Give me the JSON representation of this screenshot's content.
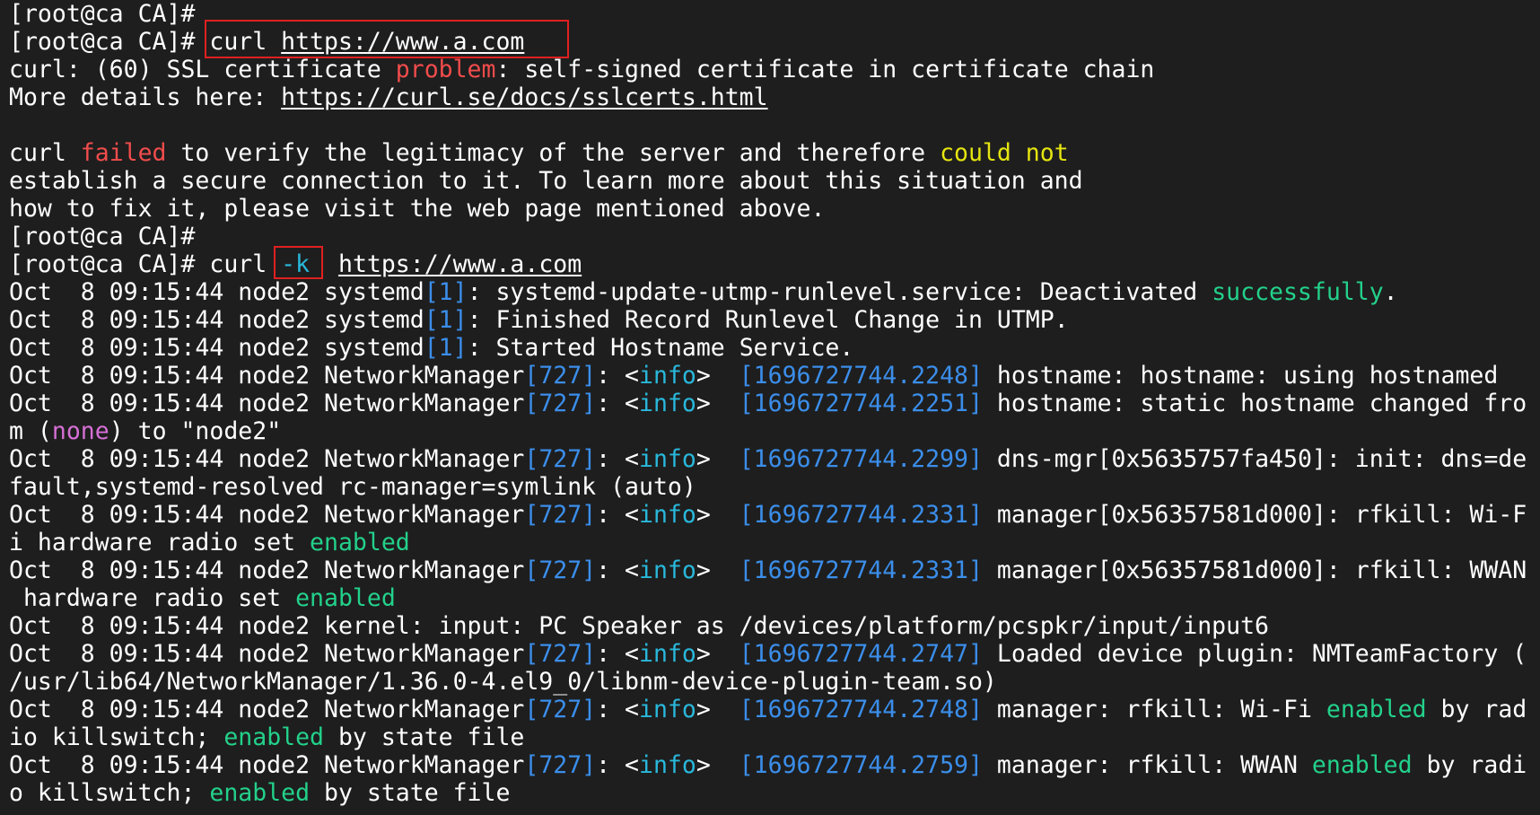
{
  "terminal": {
    "colors": {
      "background": "#1e1e1e",
      "default": "#ffffff",
      "red": "#f14c4c",
      "yellow": "#e5e510",
      "green": "#23d18b",
      "blue": "#3b8eea",
      "cyan": "#29b8db",
      "magenta": "#d670d6",
      "highlight_box": "#e02020"
    },
    "lines": [
      [
        {
          "t": "[root@ca CA]#"
        }
      ],
      [
        {
          "t": "[root@ca CA]# curl "
        },
        {
          "t": "https://www.a.com",
          "c": "default",
          "u": true
        }
      ],
      [
        {
          "t": "curl: (60) SSL certificate "
        },
        {
          "t": "problem",
          "c": "red"
        },
        {
          "t": ": self-signed certificate in certificate chain"
        }
      ],
      [
        {
          "t": "More details here: "
        },
        {
          "t": "https://curl.se/docs/sslcerts.html",
          "u": true
        }
      ],
      [
        {
          "t": ""
        }
      ],
      [
        {
          "t": "curl "
        },
        {
          "t": "failed",
          "c": "red"
        },
        {
          "t": " to verify the legitimacy of the server and therefore "
        },
        {
          "t": "could not",
          "c": "yellow"
        }
      ],
      [
        {
          "t": "establish a secure connection to it. To learn more about this situation and"
        }
      ],
      [
        {
          "t": "how to fix it, please visit the web page mentioned above."
        }
      ],
      [
        {
          "t": "[root@ca CA]#"
        }
      ],
      [
        {
          "t": "[root@ca CA]# curl "
        },
        {
          "t": "-k",
          "c": "cyan"
        },
        {
          "t": "  "
        },
        {
          "t": "https://www.a.com",
          "u": true
        }
      ],
      [
        {
          "t": "Oct  8 09:15:44 node2 systemd"
        },
        {
          "t": "[1]",
          "c": "blue"
        },
        {
          "t": ": systemd-update-utmp-runlevel.service: Deactivated "
        },
        {
          "t": "successfully",
          "c": "green"
        },
        {
          "t": "."
        }
      ],
      [
        {
          "t": "Oct  8 09:15:44 node2 systemd"
        },
        {
          "t": "[1]",
          "c": "blue"
        },
        {
          "t": ": Finished Record Runlevel Change in UTMP."
        }
      ],
      [
        {
          "t": "Oct  8 09:15:44 node2 systemd"
        },
        {
          "t": "[1]",
          "c": "blue"
        },
        {
          "t": ": Started Hostname Service."
        }
      ],
      [
        {
          "t": "Oct  8 09:15:44 node2 NetworkManager"
        },
        {
          "t": "[727]",
          "c": "blue"
        },
        {
          "t": ": <"
        },
        {
          "t": "info",
          "c": "cyan"
        },
        {
          "t": ">  "
        },
        {
          "t": "[1696727744.2248]",
          "c": "blue"
        },
        {
          "t": " hostname: hostname: using hostnamed"
        }
      ],
      [
        {
          "t": "Oct  8 09:15:44 node2 NetworkManager"
        },
        {
          "t": "[727]",
          "c": "blue"
        },
        {
          "t": ": <"
        },
        {
          "t": "info",
          "c": "cyan"
        },
        {
          "t": ">  "
        },
        {
          "t": "[1696727744.2251]",
          "c": "blue"
        },
        {
          "t": " hostname: static hostname changed fro"
        }
      ],
      [
        {
          "t": "m ("
        },
        {
          "t": "none",
          "c": "magenta"
        },
        {
          "t": ") to \"node2\""
        }
      ],
      [
        {
          "t": "Oct  8 09:15:44 node2 NetworkManager"
        },
        {
          "t": "[727]",
          "c": "blue"
        },
        {
          "t": ": <"
        },
        {
          "t": "info",
          "c": "cyan"
        },
        {
          "t": ">  "
        },
        {
          "t": "[1696727744.2299]",
          "c": "blue"
        },
        {
          "t": " dns-mgr[0x5635757fa450]: init: dns=de"
        }
      ],
      [
        {
          "t": "fault,systemd-resolved rc-manager=symlink (auto)"
        }
      ],
      [
        {
          "t": "Oct  8 09:15:44 node2 NetworkManager"
        },
        {
          "t": "[727]",
          "c": "blue"
        },
        {
          "t": ": <"
        },
        {
          "t": "info",
          "c": "cyan"
        },
        {
          "t": ">  "
        },
        {
          "t": "[1696727744.2331]",
          "c": "blue"
        },
        {
          "t": " manager[0x56357581d000]: rfkill: Wi-F"
        }
      ],
      [
        {
          "t": "i hardware radio set "
        },
        {
          "t": "enabled",
          "c": "green"
        }
      ],
      [
        {
          "t": "Oct  8 09:15:44 node2 NetworkManager"
        },
        {
          "t": "[727]",
          "c": "blue"
        },
        {
          "t": ": <"
        },
        {
          "t": "info",
          "c": "cyan"
        },
        {
          "t": ">  "
        },
        {
          "t": "[1696727744.2331]",
          "c": "blue"
        },
        {
          "t": " manager[0x56357581d000]: rfkill: WWAN"
        }
      ],
      [
        {
          "t": " hardware radio set "
        },
        {
          "t": "enabled",
          "c": "green"
        }
      ],
      [
        {
          "t": "Oct  8 09:15:44 node2 kernel: input: PC Speaker as /devices/platform/pcspkr/input/input6"
        }
      ],
      [
        {
          "t": "Oct  8 09:15:44 node2 NetworkManager"
        },
        {
          "t": "[727]",
          "c": "blue"
        },
        {
          "t": ": <"
        },
        {
          "t": "info",
          "c": "cyan"
        },
        {
          "t": ">  "
        },
        {
          "t": "[1696727744.2747]",
          "c": "blue"
        },
        {
          "t": " Loaded device plugin: NMTeamFactory ("
        }
      ],
      [
        {
          "t": "/usr/lib64/NetworkManager/1.36.0-4.el9_0/libnm-device-plugin-team.so)"
        }
      ],
      [
        {
          "t": "Oct  8 09:15:44 node2 NetworkManager"
        },
        {
          "t": "[727]",
          "c": "blue"
        },
        {
          "t": ": <"
        },
        {
          "t": "info",
          "c": "cyan"
        },
        {
          "t": ">  "
        },
        {
          "t": "[1696727744.2748]",
          "c": "blue"
        },
        {
          "t": " manager: rfkill: Wi-Fi "
        },
        {
          "t": "enabled",
          "c": "green"
        },
        {
          "t": " by rad"
        }
      ],
      [
        {
          "t": "io killswitch; "
        },
        {
          "t": "enabled",
          "c": "green"
        },
        {
          "t": " by state file"
        }
      ],
      [
        {
          "t": "Oct  8 09:15:44 node2 NetworkManager"
        },
        {
          "t": "[727]",
          "c": "blue"
        },
        {
          "t": ": <"
        },
        {
          "t": "info",
          "c": "cyan"
        },
        {
          "t": ">  "
        },
        {
          "t": "[1696727744.2759]",
          "c": "blue"
        },
        {
          "t": " manager: rfkill: WWAN "
        },
        {
          "t": "enabled",
          "c": "green"
        },
        {
          "t": " by radi"
        }
      ],
      [
        {
          "t": "o killswitch; "
        },
        {
          "t": "enabled",
          "c": "green"
        },
        {
          "t": " by state file"
        }
      ]
    ]
  }
}
